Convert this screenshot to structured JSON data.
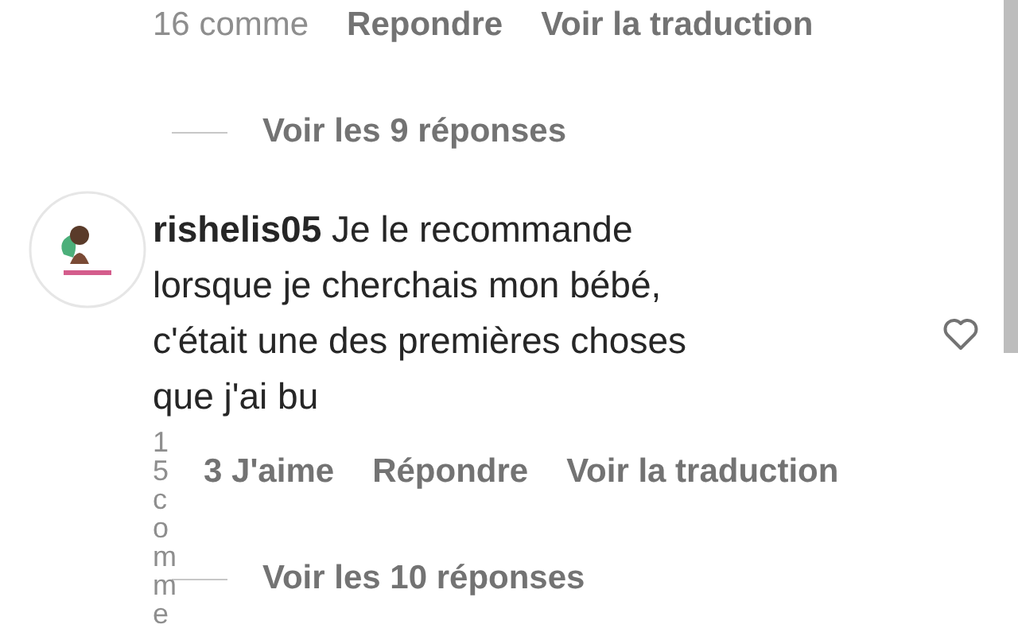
{
  "comments": [
    {
      "kind": "partial",
      "time": "16 comme",
      "actions": [
        "Repondre",
        "Voir la traduction"
      ],
      "replies_link": "Voir les 9 réponses"
    },
    {
      "kind": "full",
      "lines": [
        "**rishelis05** Je le recommande",
        "lorsque je cherchais mon bébé,",
        "c'était une des premières choses",
        "que j'ai bu"
      ],
      "time": "15 comme",
      "likes": "3 J'aime",
      "actions": [
        "Répondre",
        "Voir la traduction"
      ],
      "liked": false,
      "replies_link": "Voir les 10 réponses"
    }
  ]
}
